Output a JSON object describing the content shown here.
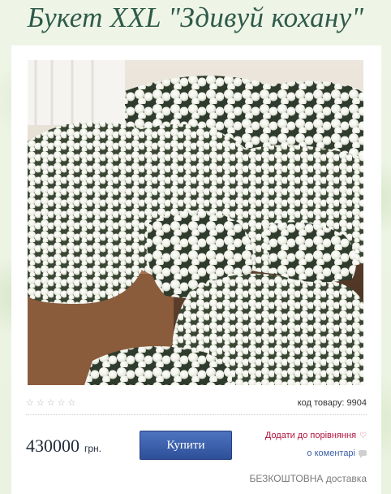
{
  "product": {
    "title": "Букет XXL \"Здивуй кохану\"",
    "image_alt": "white roses bouquet photo",
    "rating_stars": [
      "☆",
      "☆",
      "☆",
      "☆",
      "☆"
    ],
    "sku_label": "код товару:",
    "sku_value": "9904",
    "price": "430000",
    "currency": "грн.",
    "buy_label": "Купити",
    "compare_label": "Додати до порівняння",
    "comments_label": "о коментарі",
    "delivery_text": "БЕЗКОШТОВНА доставка"
  },
  "colors": {
    "background": "#eef4e4",
    "title": "#2f5a4a",
    "button": "#2e4f98",
    "compare_link": "#b3123b",
    "comments_link": "#3b5ea8"
  }
}
